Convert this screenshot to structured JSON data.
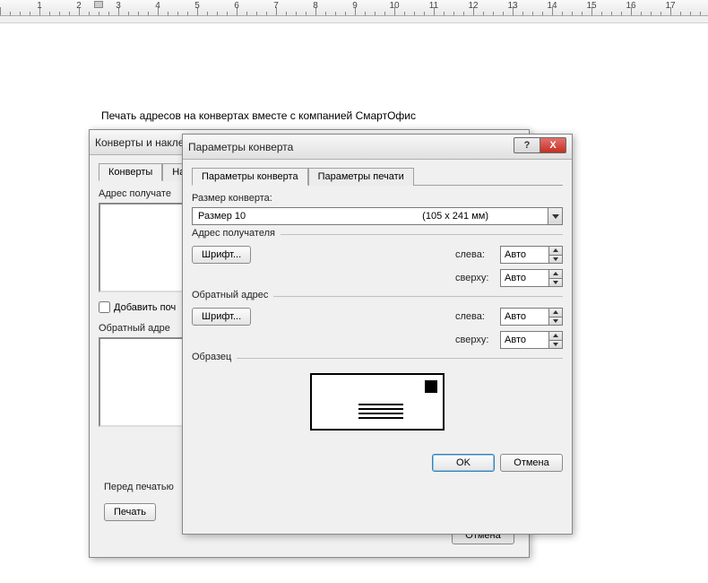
{
  "ruler": {
    "max": 17
  },
  "doc": {
    "heading": "Печать адресов на конвертах вместе с компанией СмартОфис"
  },
  "back_dialog": {
    "title": "Конверты и накле",
    "tabs": [
      "Конверты",
      "На"
    ],
    "recipient_label": "Адрес получате",
    "add_mail_label": "Добавить поч",
    "return_label": "Обратный адре",
    "preprint_label": "Перед печатью",
    "print_btn": "Печать",
    "cancel_btn": "Отмена"
  },
  "front_dialog": {
    "title": "Параметры конверта",
    "tabs": [
      "Параметры конверта",
      "Параметры  печати"
    ],
    "size_label": "Размер конверта:",
    "size_combo": {
      "name": "Размер 10",
      "dim": "(105 x 241 мм)"
    },
    "recipient_group": "Адрес получателя",
    "return_group": "Обратный адрес",
    "font_btn": "Шрифт...",
    "left_label": "слева:",
    "top_label": "сверху:",
    "auto_value": "Авто",
    "sample_label": "Образец",
    "ok_btn": "OK",
    "cancel_btn": "Отмена"
  }
}
